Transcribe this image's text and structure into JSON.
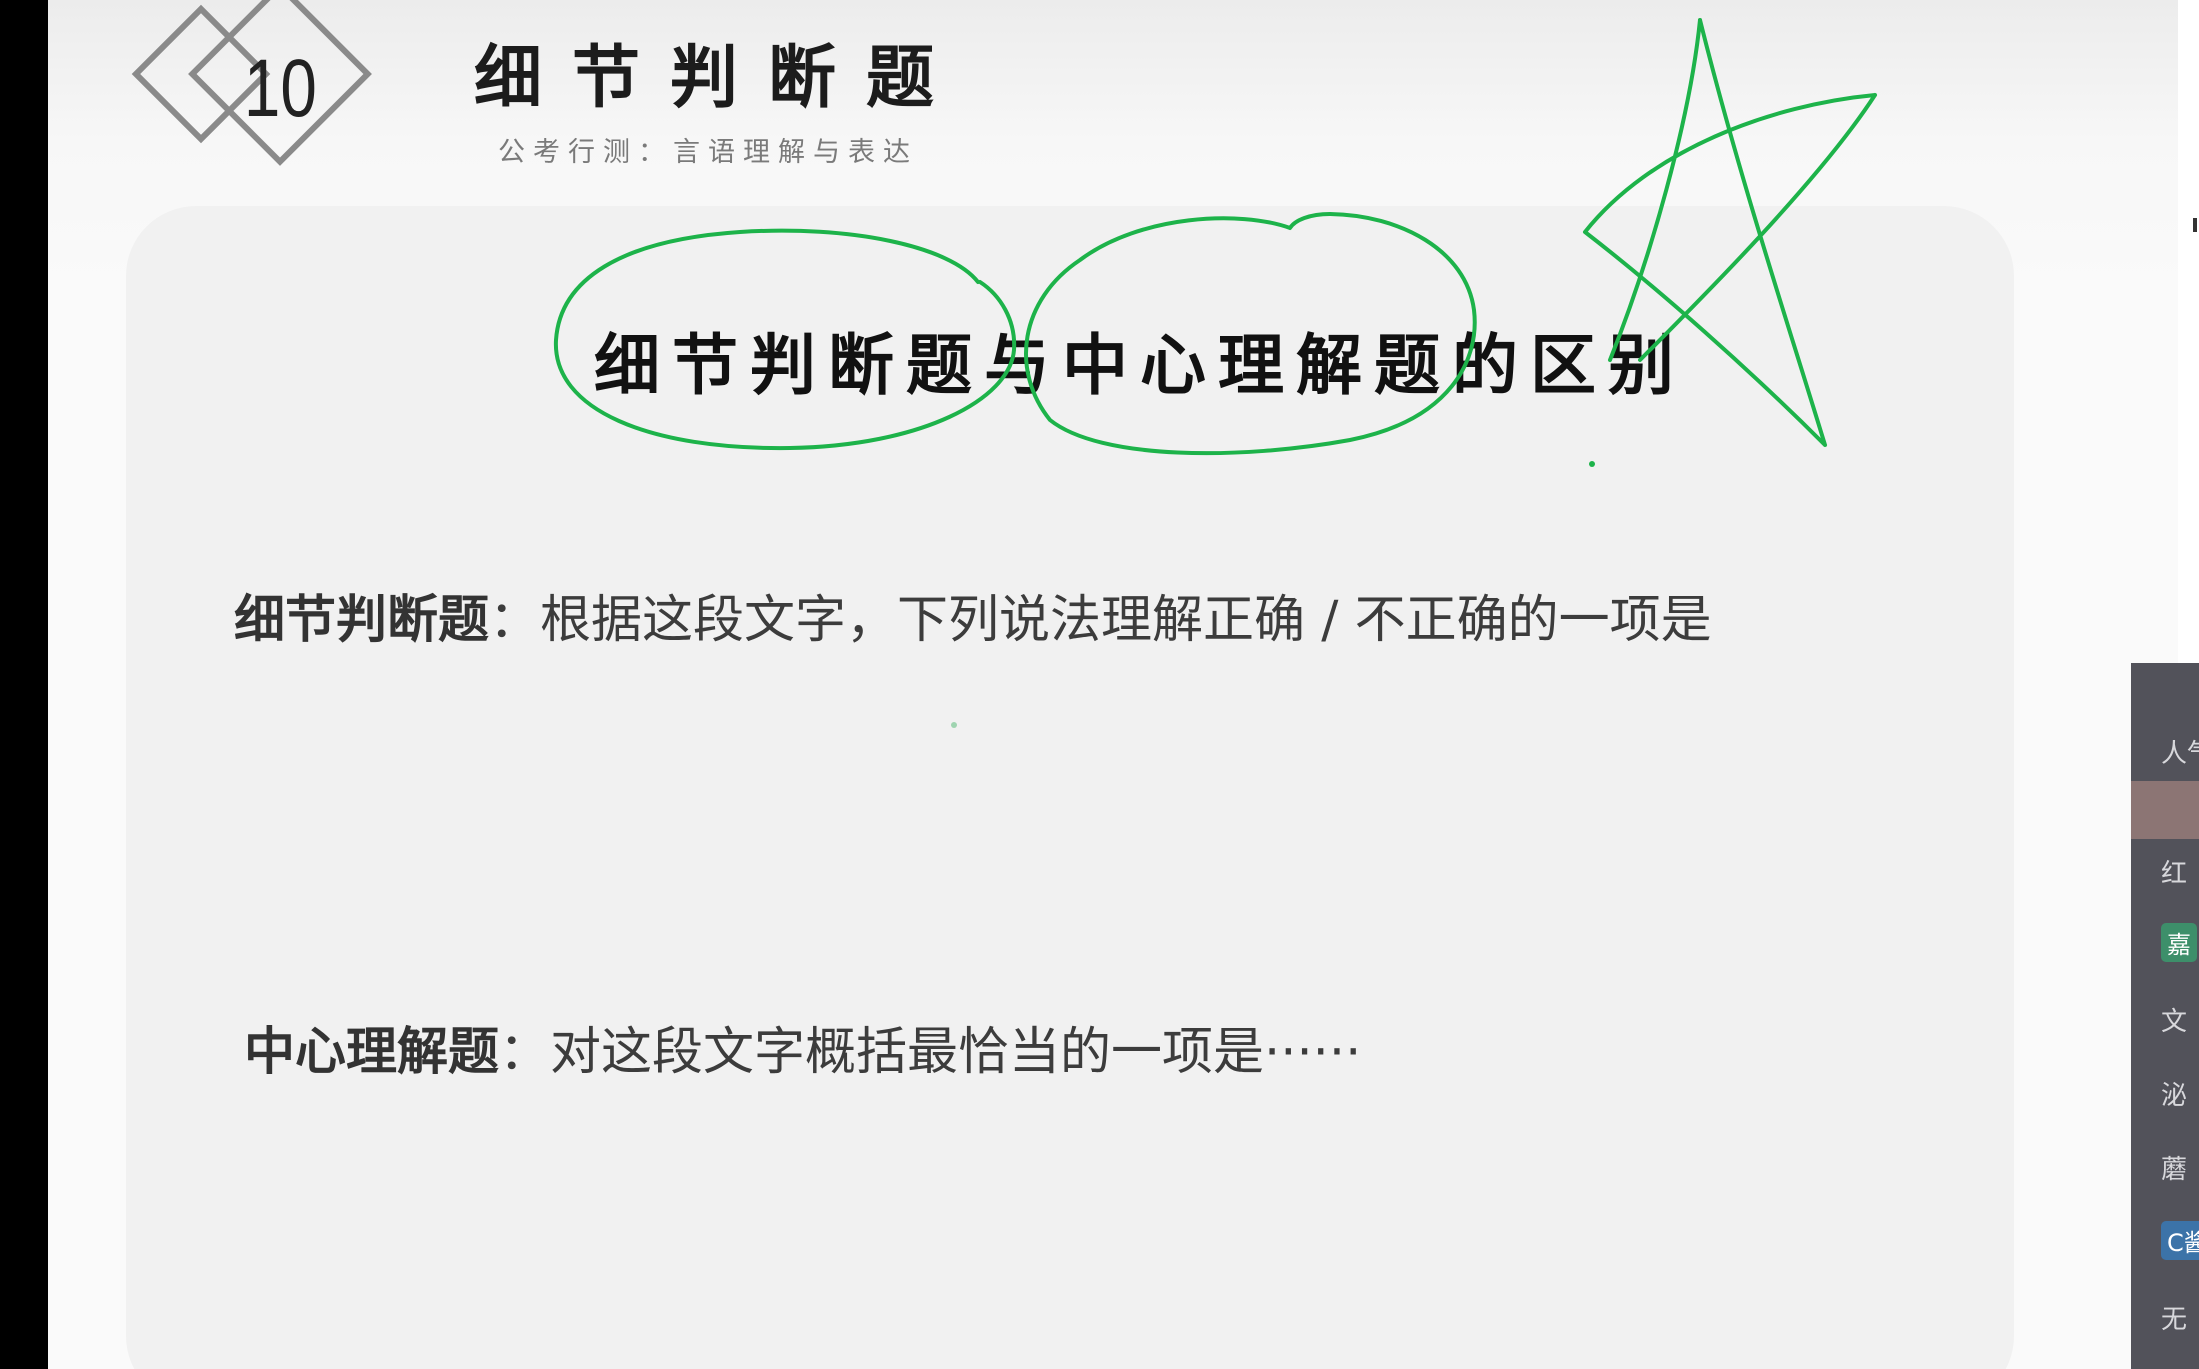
{
  "header": {
    "chapter_number": "10",
    "title": "细节判断题",
    "subtitle": "公考行测：言语理解与表达"
  },
  "slide": {
    "heading": "细节判断题与中心理解题的区别",
    "detail_term": "细节判断题",
    "detail_text": "：根据这段文字，下列说法理解正确 / 不正确的一项是",
    "center_term": "中心理解题",
    "center_text": "：对这段文字概括最恰当的一项是······"
  },
  "side_panel": {
    "items": [
      "人气",
      "红",
      "文",
      "泌",
      "蘑",
      "无"
    ],
    "badges": [
      "嘉",
      "C酱"
    ]
  },
  "colors": {
    "annotation_ink": "#1db34a",
    "card_background": "#f1f1f1",
    "side_panel": "#52525a"
  }
}
